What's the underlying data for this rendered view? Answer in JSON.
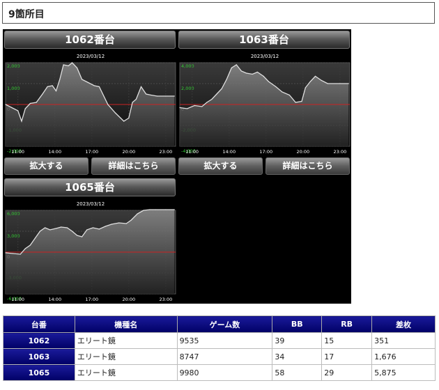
{
  "section": {
    "title": "9箇所目"
  },
  "buttons": {
    "zoom": "拡大する",
    "detail": "詳細はこちら"
  },
  "chart_data": [
    {
      "type": "area",
      "title": "1062番台",
      "date": "2023/03/12",
      "ylim": [
        -2000,
        2000
      ],
      "y_ticks": [
        "2,000",
        "1,000",
        "0",
        "-1,000",
        "-2,000"
      ],
      "x_ticks": [
        "11:00",
        "14:00",
        "17:00",
        "20:00",
        "23:00"
      ],
      "x": [
        10,
        10.5,
        11,
        11.3,
        11.6,
        12,
        12.5,
        13,
        13.4,
        13.8,
        14.1,
        14.4,
        14.7,
        15.1,
        15.4,
        15.8,
        16.2,
        16.7,
        17.2,
        17.6,
        18.3,
        18.9,
        19.6,
        20,
        20.3,
        20.6,
        21,
        21.4,
        21.8,
        22.3,
        23,
        23.7
      ],
      "y": [
        0,
        -150,
        -300,
        -800,
        -200,
        50,
        100,
        500,
        850,
        900,
        650,
        1200,
        1900,
        1850,
        2000,
        1750,
        1200,
        1050,
        900,
        850,
        0,
        -400,
        -800,
        -650,
        100,
        250,
        850,
        500,
        450,
        400,
        400,
        400
      ]
    },
    {
      "type": "area",
      "title": "1063番台",
      "date": "2023/03/12",
      "ylim": [
        -4000,
        4000
      ],
      "y_ticks": [
        "4,000",
        "2,000",
        "0",
        "-2,000",
        "-4,000"
      ],
      "x_ticks": [
        "11:00",
        "14:00",
        "17:00",
        "20:00",
        "23:00"
      ],
      "x": [
        10,
        10.6,
        11.2,
        11.8,
        12.2,
        12.6,
        13,
        13.4,
        13.8,
        14.2,
        14.6,
        15,
        15.4,
        15.9,
        16.3,
        16.8,
        17.2,
        17.8,
        18.3,
        18.9,
        19.4,
        19.9,
        20.2,
        20.6,
        21,
        21.5,
        22,
        23,
        23.7
      ],
      "y": [
        -300,
        -400,
        -100,
        -200,
        200,
        500,
        1000,
        1500,
        2400,
        3500,
        3800,
        3200,
        3000,
        2900,
        3100,
        2700,
        2200,
        1700,
        1200,
        900,
        200,
        300,
        1600,
        2200,
        2700,
        2300,
        2000,
        2000,
        2000
      ]
    },
    {
      "type": "area",
      "title": "1065番台",
      "date": "2023/03/12",
      "ylim": [
        -6000,
        6000
      ],
      "y_ticks": [
        "6,000",
        "3,000",
        "0",
        "-3,000",
        "-6,000"
      ],
      "x_ticks": [
        "11:00",
        "14:00",
        "17:00",
        "20:00",
        "23:00"
      ],
      "x": [
        10,
        10.6,
        11.2,
        11.6,
        12,
        12.4,
        12.8,
        13.2,
        13.6,
        14.1,
        14.5,
        15,
        15.4,
        15.8,
        16.2,
        16.6,
        17.1,
        17.6,
        18.1,
        18.6,
        19.2,
        19.8,
        20.2,
        20.7,
        21.2,
        21.7,
        22.2,
        23,
        23.7
      ],
      "y": [
        -100,
        -200,
        -300,
        500,
        1000,
        2000,
        3000,
        3500,
        3200,
        3400,
        3600,
        3500,
        3000,
        2400,
        2200,
        3200,
        3500,
        3300,
        3700,
        4000,
        4200,
        4100,
        4600,
        5500,
        6000,
        6100,
        6100,
        6100,
        6100
      ]
    }
  ],
  "table": {
    "headers": [
      "台番",
      "機種名",
      "ゲーム数",
      "BB",
      "RB",
      "差枚"
    ],
    "rows": [
      [
        "1062",
        "エリート鏡",
        "9535",
        "39",
        "15",
        "351"
      ],
      [
        "1063",
        "エリート鏡",
        "8747",
        "34",
        "17",
        "1,676"
      ],
      [
        "1065",
        "エリート鏡",
        "9980",
        "58",
        "29",
        "5,875"
      ]
    ]
  },
  "colors": {
    "header_blue": "#000066",
    "zero_line": "#cc2222",
    "tick_green": "#33cc33",
    "line": "#e0e0e0"
  }
}
